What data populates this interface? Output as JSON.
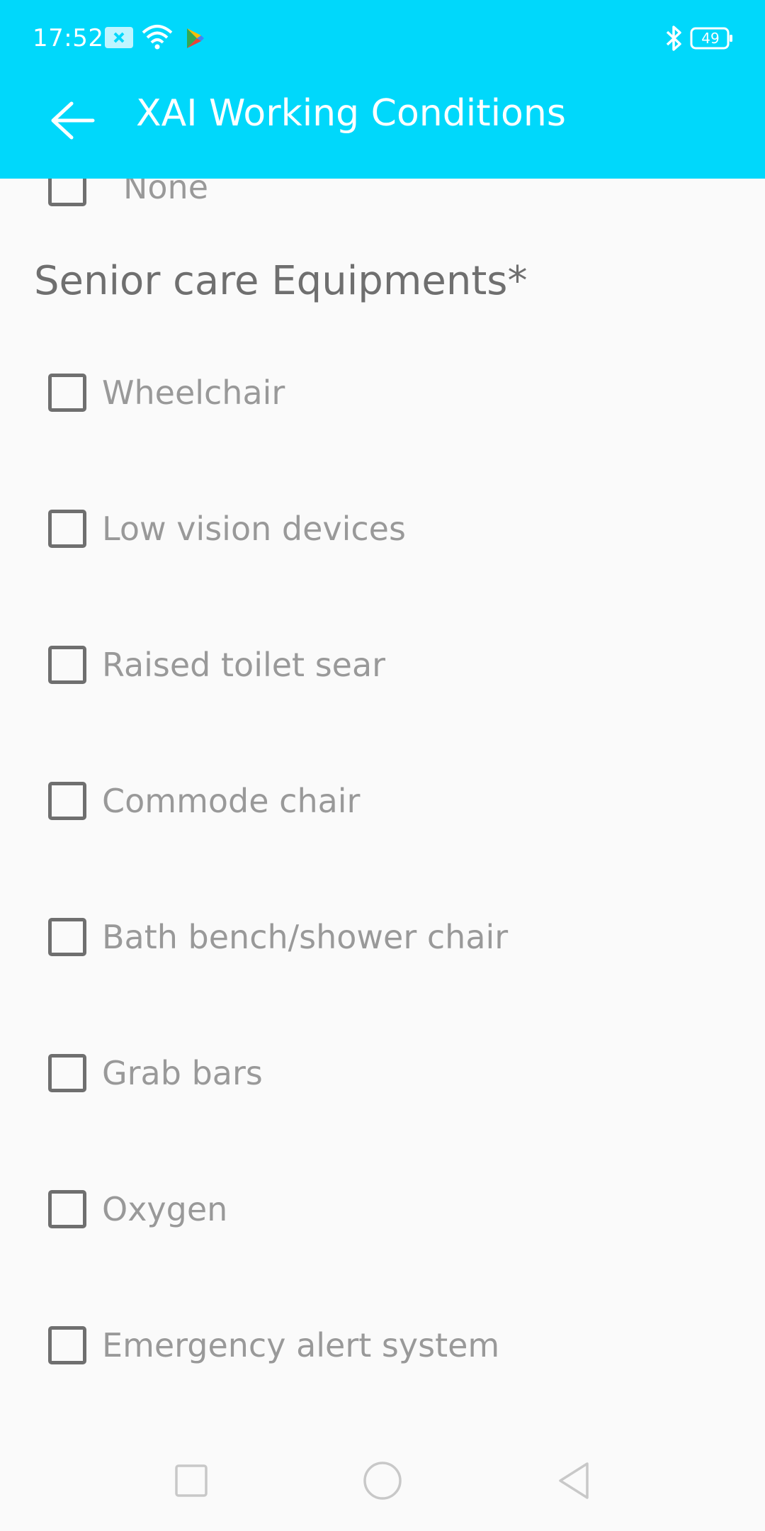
{
  "status_bar": {
    "time": "17:52",
    "battery": "49",
    "icons": [
      "notification-icon",
      "wifi-icon",
      "play-store-icon",
      "bluetooth-icon",
      "battery-icon"
    ]
  },
  "app_bar": {
    "title": "XAI Working Conditions",
    "background_color": "#00d8fb",
    "back_icon": "arrow-left-icon"
  },
  "partial_item": {
    "label": "None",
    "checked": false
  },
  "section": {
    "title": "Senior care Equipments*",
    "items": [
      {
        "label": "Wheelchair",
        "checked": false
      },
      {
        "label": "Low vision devices",
        "checked": false
      },
      {
        "label": "Raised toilet sear",
        "checked": false
      },
      {
        "label": "Commode chair",
        "checked": false
      },
      {
        "label": "Bath bench/shower chair",
        "checked": false
      },
      {
        "label": "Grab bars",
        "checked": false
      },
      {
        "label": "Oxygen",
        "checked": false
      },
      {
        "label": "Emergency alert system",
        "checked": false
      }
    ]
  },
  "nav_bar": {
    "buttons": [
      "recents-icon",
      "home-icon",
      "back-triangle-icon"
    ]
  }
}
